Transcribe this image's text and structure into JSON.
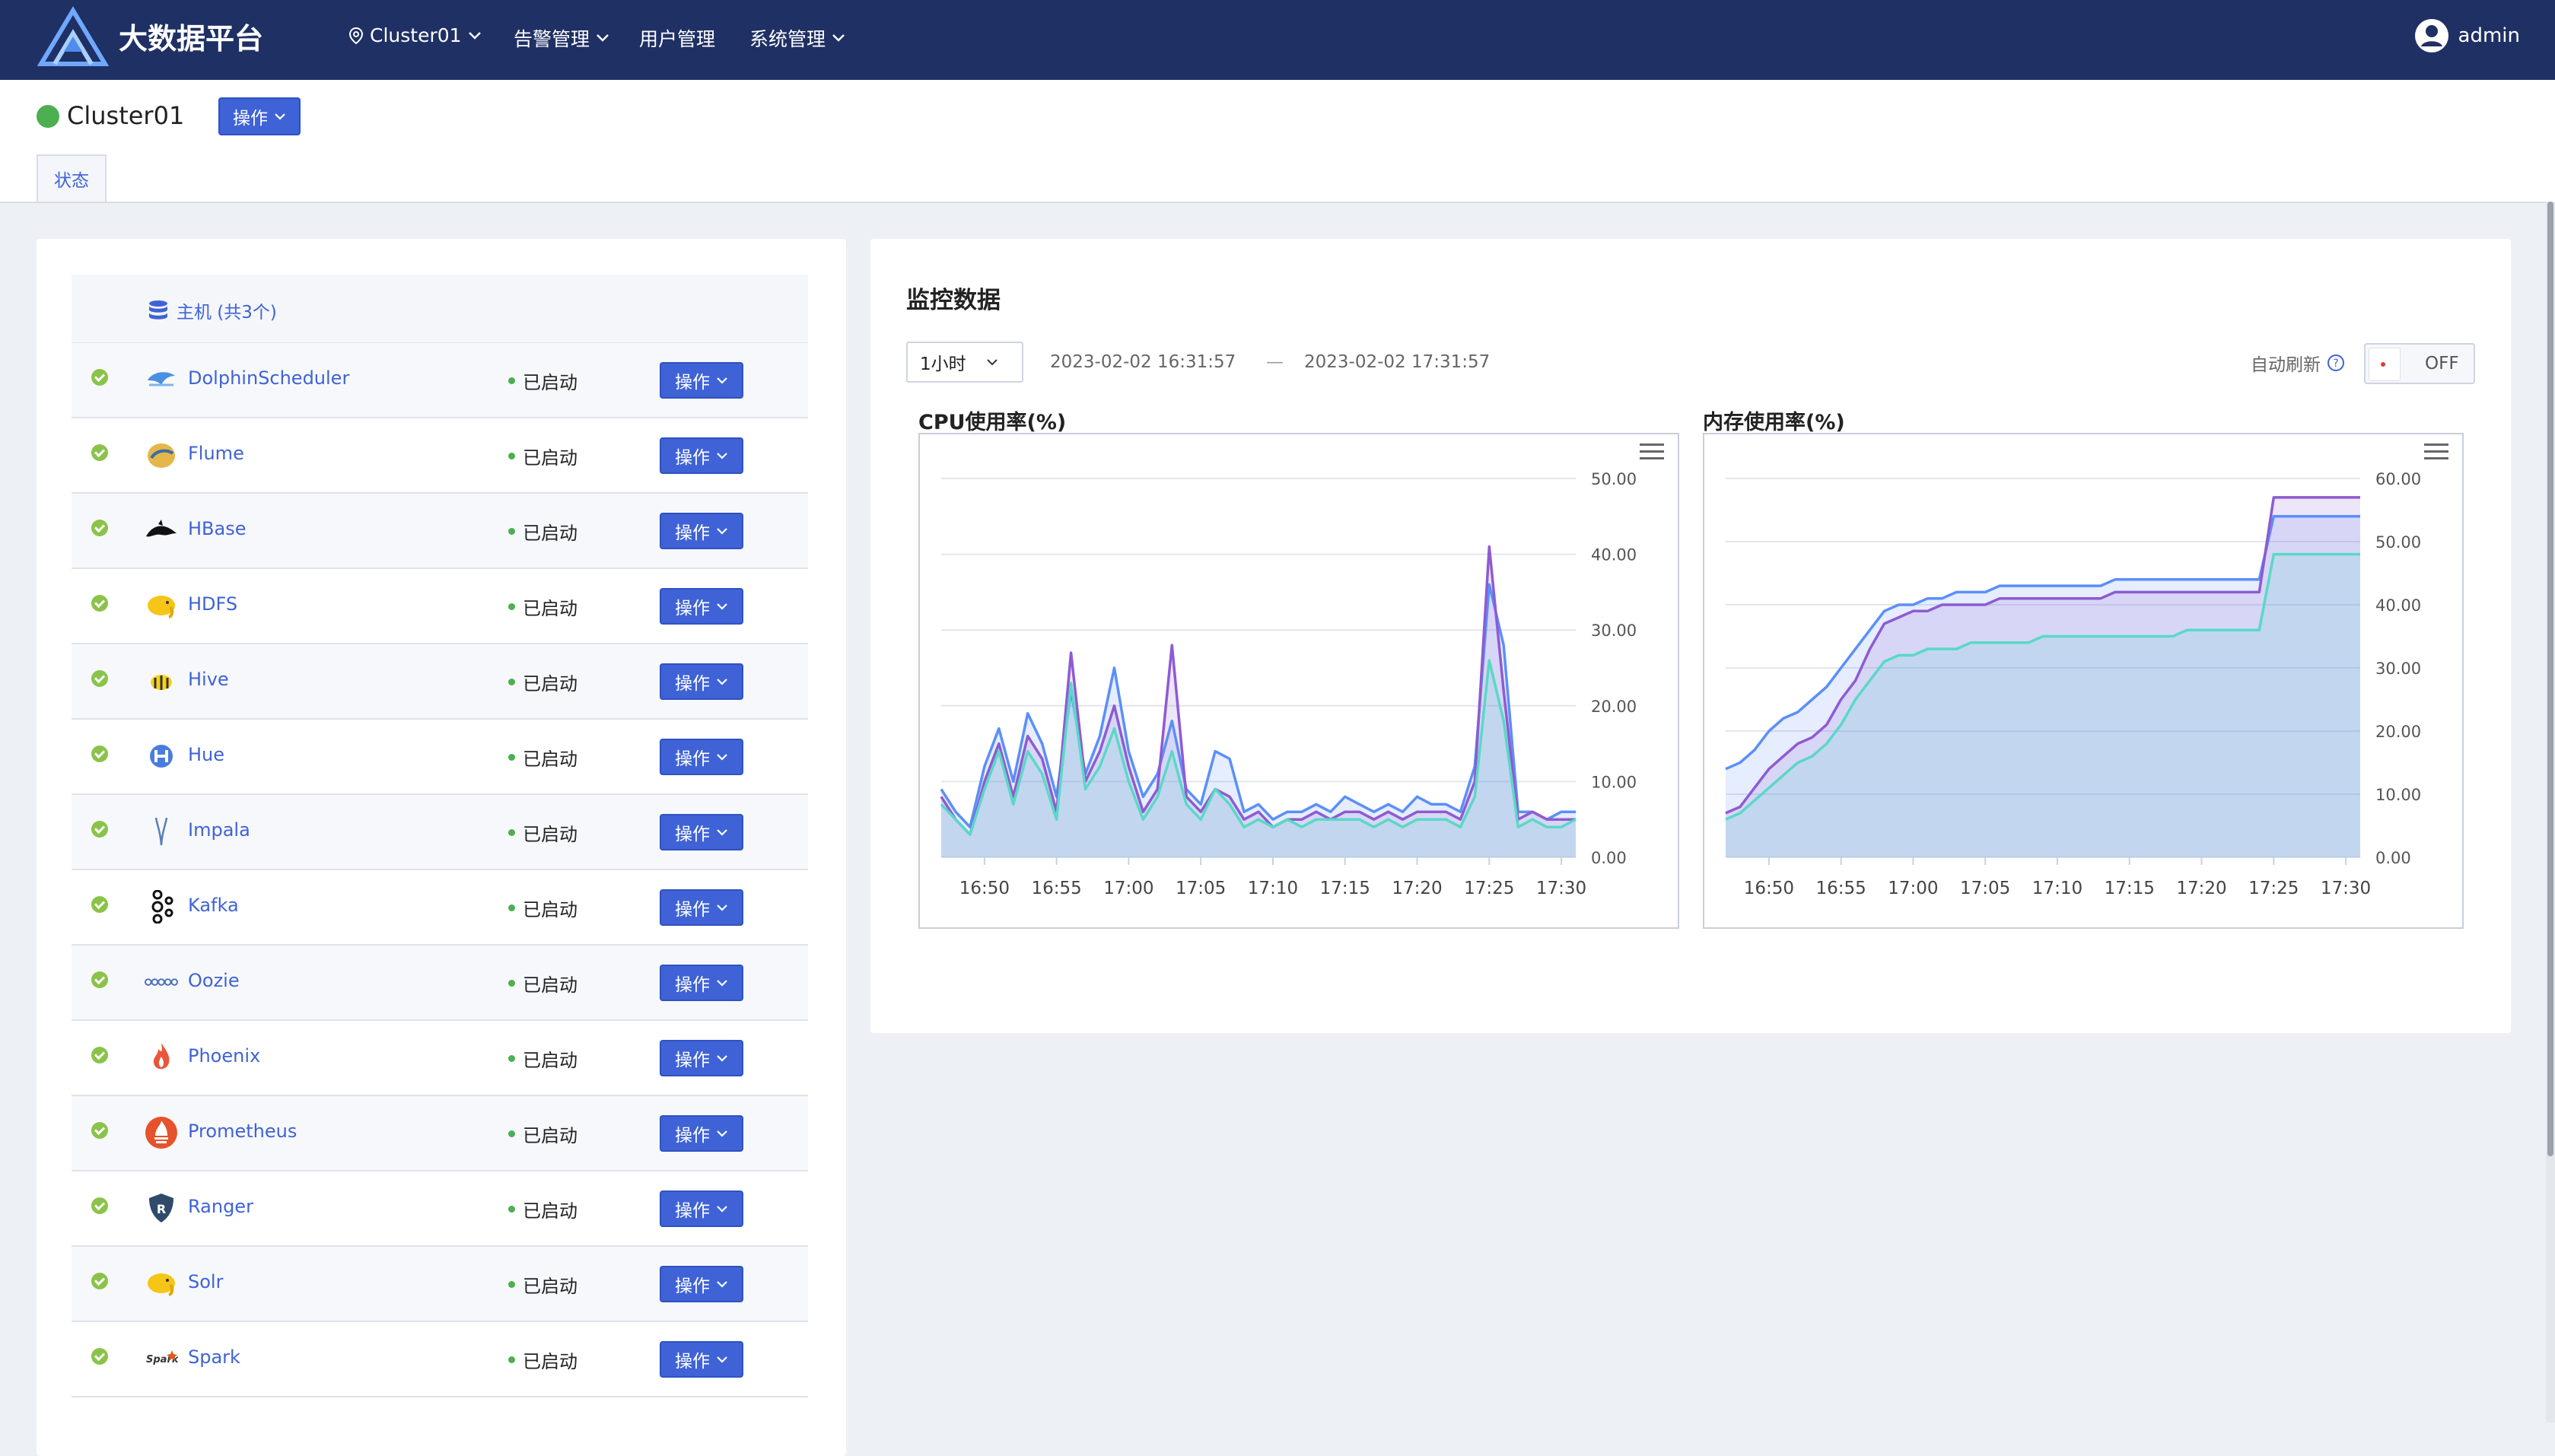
{
  "app": {
    "title": "大数据平台",
    "user": "admin"
  },
  "nav": [
    {
      "label": "Cluster01",
      "icon": "location-icon",
      "dropdown": true
    },
    {
      "label": "告警管理",
      "dropdown": true
    },
    {
      "label": "用户管理",
      "dropdown": false
    },
    {
      "label": "系统管理",
      "dropdown": true
    }
  ],
  "cluster": {
    "name": "Cluster01",
    "status_color": "#4caf50",
    "ops_label": "操作"
  },
  "tabs": [
    {
      "label": "状态"
    }
  ],
  "hosts": {
    "label": "主机 (共3个)"
  },
  "services": [
    {
      "name": "DolphinScheduler",
      "status": "已启动",
      "ops": "操作",
      "logo": "dolphin-icon"
    },
    {
      "name": "Flume",
      "status": "已启动",
      "ops": "操作",
      "logo": "flume-icon"
    },
    {
      "name": "HBase",
      "status": "已启动",
      "ops": "操作",
      "logo": "orca-icon"
    },
    {
      "name": "HDFS",
      "status": "已启动",
      "ops": "操作",
      "logo": "elephant-icon"
    },
    {
      "name": "Hive",
      "status": "已启动",
      "ops": "操作",
      "logo": "bee-icon"
    },
    {
      "name": "Hue",
      "status": "已启动",
      "ops": "操作",
      "logo": "hue-icon"
    },
    {
      "name": "Impala",
      "status": "已启动",
      "ops": "操作",
      "logo": "antelope-icon"
    },
    {
      "name": "Kafka",
      "status": "已启动",
      "ops": "操作",
      "logo": "kafka-icon"
    },
    {
      "name": "Oozie",
      "status": "已启动",
      "ops": "操作",
      "logo": "oozie-icon"
    },
    {
      "name": "Phoenix",
      "status": "已启动",
      "ops": "操作",
      "logo": "flame-icon"
    },
    {
      "name": "Prometheus",
      "status": "已启动",
      "ops": "操作",
      "logo": "torch-icon"
    },
    {
      "name": "Ranger",
      "status": "已启动",
      "ops": "操作",
      "logo": "shield-icon"
    },
    {
      "name": "Solr",
      "status": "已启动",
      "ops": "操作",
      "logo": "sun-icon"
    },
    {
      "name": "Spark",
      "status": "已启动",
      "ops": "操作",
      "logo": "spark-icon"
    }
  ],
  "monitor": {
    "title": "监控数据",
    "range": "1小时",
    "start": "2023-02-02 16:31:57",
    "dash": "—",
    "end": "2023-02-02 17:31:57",
    "auto_refresh_label": "自动刷新",
    "toggle": "OFF"
  },
  "chart_data": [
    {
      "type": "area",
      "title": "CPU使用率(%)",
      "x": [
        "16:47",
        "16:48",
        "16:49",
        "16:50",
        "16:51",
        "16:52",
        "16:53",
        "16:54",
        "16:55",
        "16:56",
        "16:57",
        "16:58",
        "16:59",
        "17:00",
        "17:01",
        "17:02",
        "17:03",
        "17:04",
        "17:05",
        "17:06",
        "17:07",
        "17:08",
        "17:09",
        "17:10",
        "17:11",
        "17:12",
        "17:13",
        "17:14",
        "17:15",
        "17:16",
        "17:17",
        "17:18",
        "17:19",
        "17:20",
        "17:21",
        "17:22",
        "17:23",
        "17:24",
        "17:25",
        "17:26",
        "17:27",
        "17:28",
        "17:29",
        "17:30",
        "17:31"
      ],
      "xticks": [
        "16:50",
        "16:55",
        "17:00",
        "17:05",
        "17:10",
        "17:15",
        "17:20",
        "17:25",
        "17:30"
      ],
      "ylim": [
        0,
        50
      ],
      "yticks": [
        "0.00",
        "10.00",
        "20.00",
        "30.00",
        "40.00",
        "50.00"
      ],
      "colors": [
        "#5b8ff9",
        "#8e5bd2",
        "#5ad8c6"
      ],
      "series": [
        {
          "values": [
            9,
            6,
            4,
            12,
            17,
            10,
            19,
            15,
            8,
            22,
            11,
            16,
            25,
            14,
            8,
            11,
            18,
            9,
            7,
            14,
            13,
            6,
            7,
            5,
            6,
            6,
            7,
            6,
            8,
            7,
            6,
            7,
            6,
            8,
            7,
            7,
            6,
            12,
            36,
            28,
            6,
            6,
            5,
            6,
            6
          ]
        },
        {
          "values": [
            8,
            5,
            3,
            10,
            15,
            8,
            16,
            13,
            6,
            27,
            10,
            14,
            20,
            12,
            6,
            9,
            28,
            8,
            6,
            9,
            8,
            5,
            6,
            4,
            5,
            5,
            6,
            5,
            6,
            6,
            5,
            6,
            5,
            6,
            6,
            6,
            5,
            10,
            41,
            22,
            5,
            6,
            5,
            5,
            5
          ]
        },
        {
          "values": [
            7,
            5,
            3,
            9,
            14,
            7,
            14,
            11,
            5,
            23,
            9,
            12,
            17,
            10,
            5,
            8,
            14,
            7,
            5,
            9,
            7,
            4,
            5,
            4,
            5,
            4,
            5,
            5,
            5,
            5,
            4,
            5,
            4,
            5,
            5,
            5,
            4,
            8,
            26,
            18,
            4,
            5,
            4,
            4,
            5
          ]
        }
      ]
    },
    {
      "type": "area",
      "title": "内存使用率(%)",
      "x": [
        "16:47",
        "16:48",
        "16:49",
        "16:50",
        "16:51",
        "16:52",
        "16:53",
        "16:54",
        "16:55",
        "16:56",
        "16:57",
        "16:58",
        "16:59",
        "17:00",
        "17:01",
        "17:02",
        "17:03",
        "17:04",
        "17:05",
        "17:06",
        "17:07",
        "17:08",
        "17:09",
        "17:10",
        "17:11",
        "17:12",
        "17:13",
        "17:14",
        "17:15",
        "17:16",
        "17:17",
        "17:18",
        "17:19",
        "17:20",
        "17:21",
        "17:22",
        "17:23",
        "17:24",
        "17:25",
        "17:26",
        "17:27",
        "17:28",
        "17:29",
        "17:30",
        "17:31"
      ],
      "xticks": [
        "16:50",
        "16:55",
        "17:00",
        "17:05",
        "17:10",
        "17:15",
        "17:20",
        "17:25",
        "17:30"
      ],
      "ylim": [
        0,
        60
      ],
      "yticks": [
        "0.00",
        "10.00",
        "20.00",
        "30.00",
        "40.00",
        "50.00",
        "60.00"
      ],
      "colors": [
        "#5b8ff9",
        "#8e5bd2",
        "#5ad8c6"
      ],
      "series": [
        {
          "values": [
            14,
            15,
            17,
            20,
            22,
            23,
            25,
            27,
            30,
            33,
            36,
            39,
            40,
            40,
            41,
            41,
            42,
            42,
            42,
            43,
            43,
            43,
            43,
            43,
            43,
            43,
            43,
            44,
            44,
            44,
            44,
            44,
            44,
            44,
            44,
            44,
            44,
            44,
            54,
            54,
            54,
            54,
            54,
            54,
            54
          ]
        },
        {
          "values": [
            7,
            8,
            11,
            14,
            16,
            18,
            19,
            21,
            25,
            28,
            33,
            37,
            38,
            39,
            39,
            40,
            40,
            40,
            40,
            41,
            41,
            41,
            41,
            41,
            41,
            41,
            41,
            42,
            42,
            42,
            42,
            42,
            42,
            42,
            42,
            42,
            42,
            42,
            57,
            57,
            57,
            57,
            57,
            57,
            57
          ]
        },
        {
          "values": [
            6,
            7,
            9,
            11,
            13,
            15,
            16,
            18,
            21,
            25,
            28,
            31,
            32,
            32,
            33,
            33,
            33,
            34,
            34,
            34,
            34,
            34,
            35,
            35,
            35,
            35,
            35,
            35,
            35,
            35,
            35,
            35,
            36,
            36,
            36,
            36,
            36,
            36,
            48,
            48,
            48,
            48,
            48,
            48,
            48
          ]
        }
      ]
    }
  ]
}
